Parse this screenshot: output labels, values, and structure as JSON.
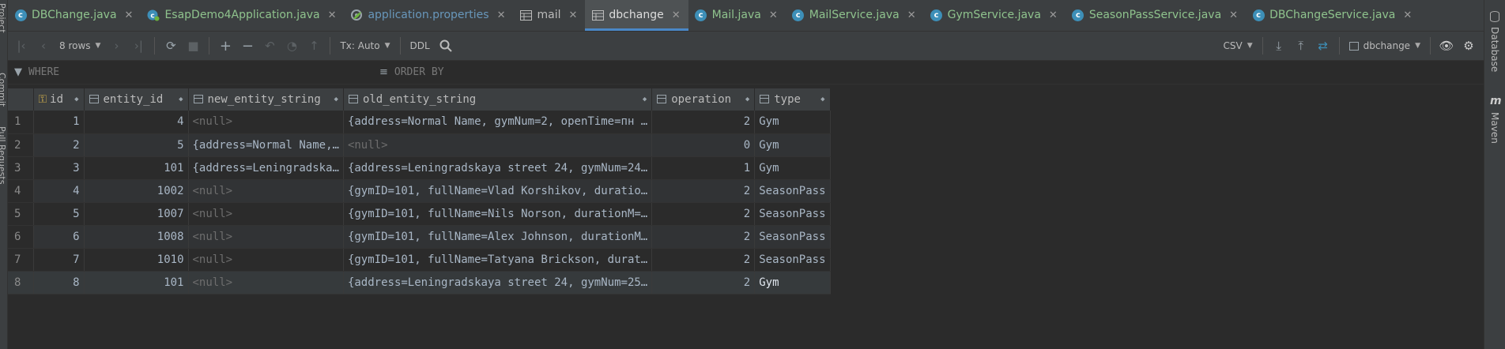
{
  "tabs": [
    {
      "label": "DBChange.java",
      "icon": "class-icon",
      "kind": "java"
    },
    {
      "label": "EsapDemo4Application.java",
      "icon": "spring-boot-class-icon",
      "kind": "java"
    },
    {
      "label": "application.properties",
      "icon": "spring-properties-icon",
      "kind": "props"
    },
    {
      "label": "mail",
      "icon": "table-icon",
      "kind": "table"
    },
    {
      "label": "dbchange",
      "icon": "table-icon",
      "kind": "table",
      "active": true
    },
    {
      "label": "Mail.java",
      "icon": "class-icon",
      "kind": "java"
    },
    {
      "label": "MailService.java",
      "icon": "class-icon",
      "kind": "java"
    },
    {
      "label": "GymService.java",
      "icon": "class-icon",
      "kind": "java"
    },
    {
      "label": "SeasonPassService.java",
      "icon": "class-icon",
      "kind": "java"
    },
    {
      "label": "DBChangeService.java",
      "icon": "class-icon",
      "kind": "java"
    }
  ],
  "toolbar": {
    "rows_label": "8 rows",
    "tx_label": "Tx: Auto",
    "ddl_label": "DDL",
    "export_format": "CSV",
    "datasource": "dbchange"
  },
  "filters": {
    "where_label": "WHERE",
    "order_label": "ORDER BY"
  },
  "side": {
    "left": [
      "Project",
      "Commit",
      "Pull Requests"
    ],
    "right": [
      "Database",
      "Maven"
    ]
  },
  "columns": [
    "id",
    "entity_id",
    "new_entity_string",
    "old_entity_string",
    "operation",
    "type"
  ],
  "rows": [
    {
      "n": "1",
      "id": "1",
      "entity_id": "4",
      "new": "<null>",
      "old": "{address=Normal Name, gymNum=2, openTime=пн …",
      "operation": "2",
      "type": "Gym"
    },
    {
      "n": "2",
      "id": "2",
      "entity_id": "5",
      "new": "{address=Normal Name,…",
      "old": "<null>",
      "operation": "0",
      "type": "Gym"
    },
    {
      "n": "3",
      "id": "3",
      "entity_id": "101",
      "new": "{address=Leningradska…",
      "old": "{address=Leningradskaya street 24, gymNum=24…",
      "operation": "1",
      "type": "Gym"
    },
    {
      "n": "4",
      "id": "4",
      "entity_id": "1002",
      "new": "<null>",
      "old": "{gymID=101, fullName=Vlad Korshikov, duratio…",
      "operation": "2",
      "type": "SeasonPass"
    },
    {
      "n": "5",
      "id": "5",
      "entity_id": "1007",
      "new": "<null>",
      "old": "{gymID=101, fullName=Nils Norson, durationM=…",
      "operation": "2",
      "type": "SeasonPass"
    },
    {
      "n": "6",
      "id": "6",
      "entity_id": "1008",
      "new": "<null>",
      "old": "{gymID=101, fullName=Alex Johnson, durationM…",
      "operation": "2",
      "type": "SeasonPass"
    },
    {
      "n": "7",
      "id": "7",
      "entity_id": "1010",
      "new": "<null>",
      "old": "{gymID=101, fullName=Tatyana Brickson, durat…",
      "operation": "2",
      "type": "SeasonPass"
    },
    {
      "n": "8",
      "id": "8",
      "entity_id": "101",
      "new": "<null>",
      "old": "{address=Leningradskaya street 24, gymNum=25…",
      "operation": "2",
      "type": "Gym"
    }
  ]
}
